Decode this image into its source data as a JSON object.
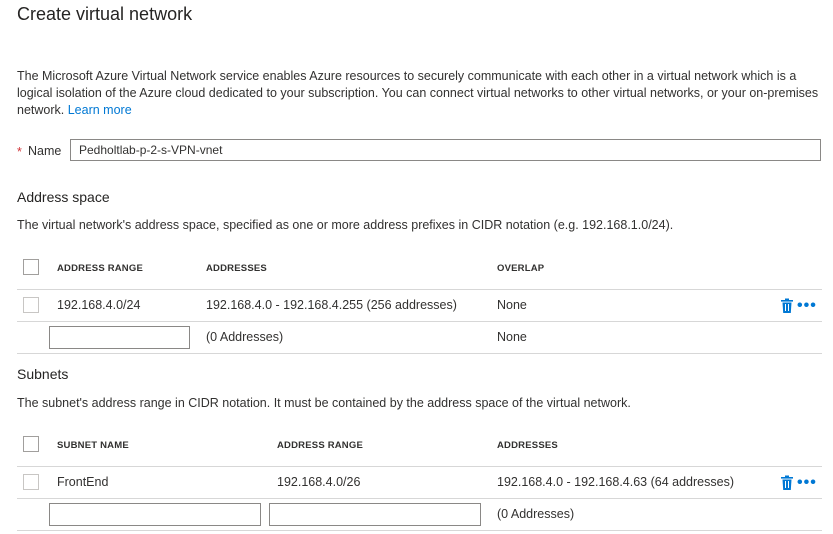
{
  "header": {
    "title": "Create virtual network"
  },
  "intro": {
    "text": "The Microsoft Azure Virtual Network service enables Azure resources to securely communicate with each other in a virtual network which is a logical isolation of the Azure cloud dedicated to your subscription. You can connect virtual networks to other virtual networks, or your on-premises network.",
    "link": "Learn more"
  },
  "name_field": {
    "required_mark": "*",
    "label": "Name",
    "value": "Pedholtlab-p-2-s-VPN-vnet"
  },
  "address_space": {
    "title": "Address space",
    "hint": "The virtual network's address space, specified as one or more address prefixes in CIDR notation (e.g. 192.168.1.0/24).",
    "columns": [
      "ADDRESS RANGE",
      "ADDRESSES",
      "OVERLAP"
    ],
    "rows": [
      {
        "range": "192.168.4.0/24",
        "addresses": "192.168.4.0 - 192.168.4.255 (256 addresses)",
        "overlap": "None"
      }
    ],
    "new_row": {
      "addresses": "(0 Addresses)",
      "overlap": "None"
    }
  },
  "subnets": {
    "title": "Subnets",
    "hint": "The subnet's address range in CIDR notation. It must be contained by the address space of the virtual network.",
    "columns": [
      "SUBNET NAME",
      "ADDRESS RANGE",
      "ADDRESSES"
    ],
    "rows": [
      {
        "name": "FrontEnd",
        "range": "192.168.4.0/26",
        "addresses": "192.168.4.0 - 192.168.4.63 (64 addresses)"
      }
    ],
    "new_row": {
      "addresses": "(0 Addresses)"
    }
  },
  "row_actions": {
    "more_label": "•••"
  },
  "colors": {
    "accent": "#0078d4",
    "required": "#d13438",
    "border": "#8a8886",
    "divider": "#d7d7d7"
  }
}
